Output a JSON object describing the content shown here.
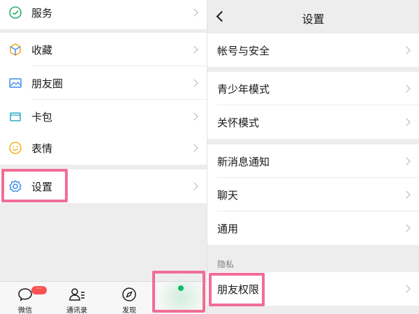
{
  "left": {
    "items": [
      {
        "label": "服务",
        "icon": "service-icon"
      },
      {
        "label": "收藏",
        "icon": "favorites-icon"
      },
      {
        "label": "朋友圈",
        "icon": "moments-icon"
      },
      {
        "label": "卡包",
        "icon": "card-pack-icon"
      },
      {
        "label": "表情",
        "icon": "sticker-icon"
      },
      {
        "label": "设置",
        "icon": "settings-icon"
      }
    ],
    "tabs": [
      {
        "label": "微信",
        "icon": "chat-icon"
      },
      {
        "label": "通讯录",
        "icon": "contacts-icon"
      },
      {
        "label": "发现",
        "icon": "discover-icon"
      }
    ],
    "badge": "···"
  },
  "right": {
    "title": "设置",
    "items": [
      {
        "label": "帐号与安全"
      },
      {
        "label": "青少年模式"
      },
      {
        "label": "关怀模式"
      },
      {
        "label": "新消息通知"
      },
      {
        "label": "聊天"
      },
      {
        "label": "通用"
      }
    ],
    "section_title": "隐私",
    "privacy_items": [
      {
        "label": "朋友权限"
      }
    ]
  },
  "colors": {
    "accent_green": "#07c160",
    "highlight_pink": "#f06e96",
    "badge_red": "#fa5151",
    "background": "#ededed"
  }
}
